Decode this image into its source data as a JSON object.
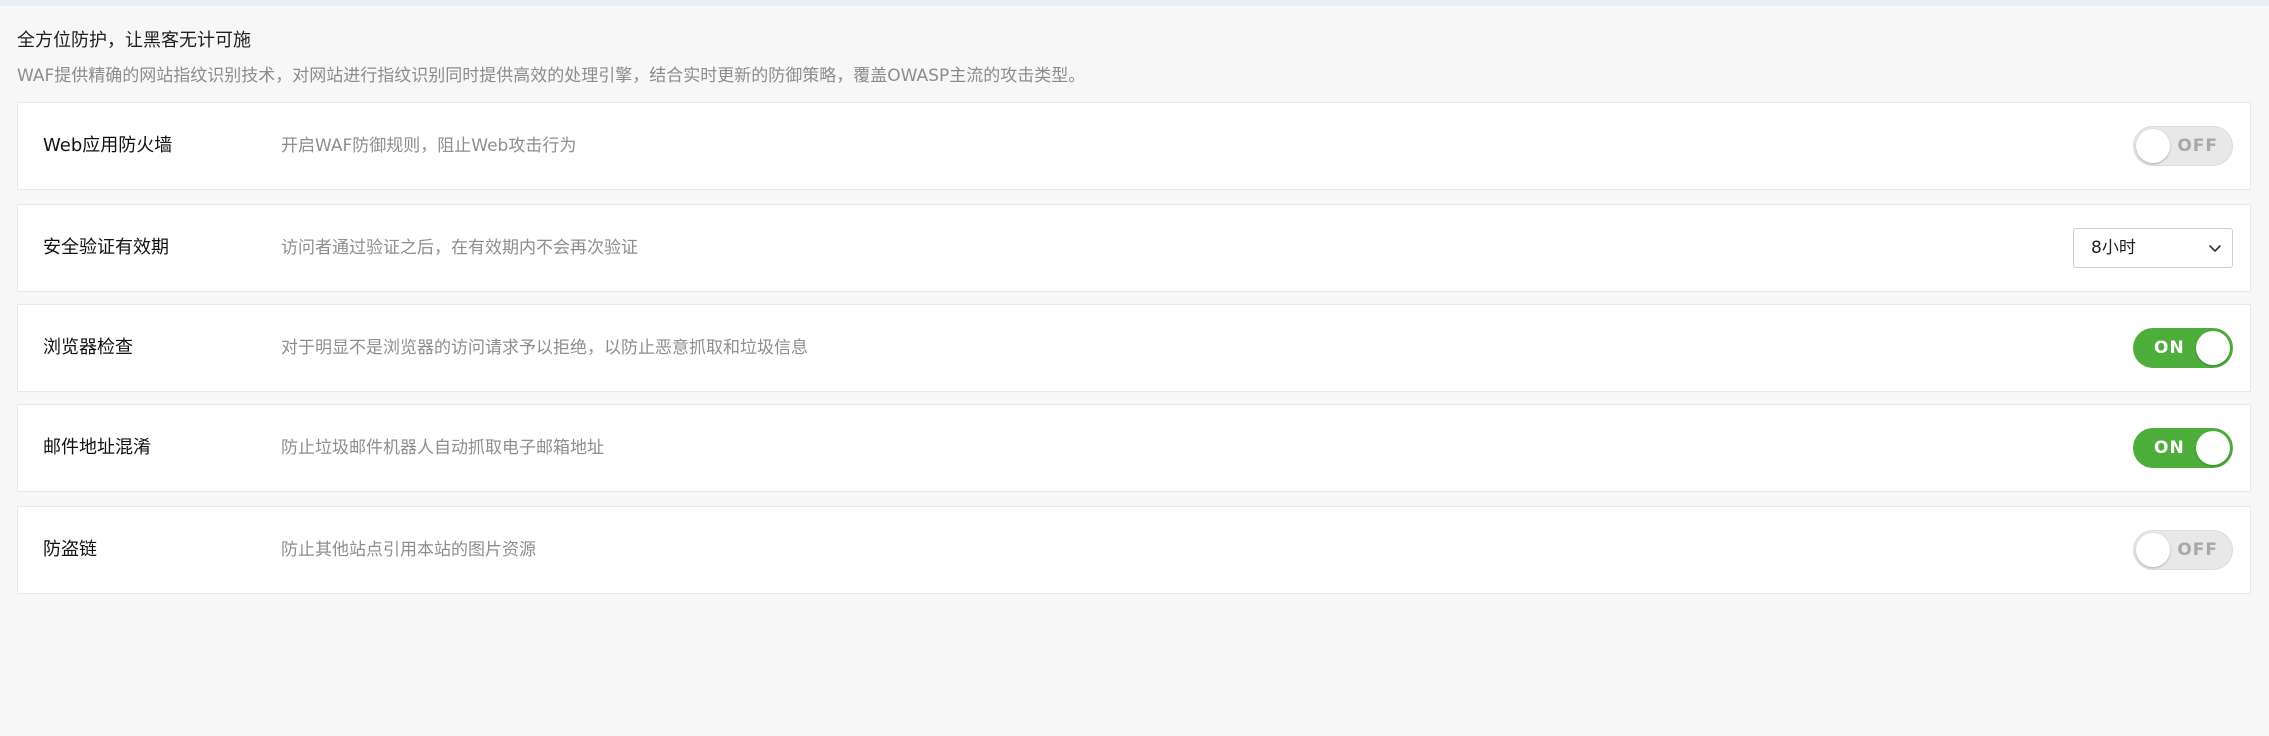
{
  "intro": {
    "title": "全方位防护，让黑客无计可施",
    "description": "WAF提供精确的网站指纹识别技术，对网站进行指纹识别同时提供高效的处理引擎，结合实时更新的防御策略，覆盖OWASP主流的攻击类型。"
  },
  "settings": [
    {
      "label": "Web应用防火墙",
      "description": "开启WAF防御规则，阻止Web攻击行为",
      "control": "toggle",
      "state_label": "OFF",
      "enabled": false
    },
    {
      "label": "安全验证有效期",
      "description": "访问者通过验证之后，在有效期内不会再次验证",
      "control": "select",
      "selected_value": "8小时",
      "icon": "chevron-down-icon"
    },
    {
      "label": "浏览器检查",
      "description": "对于明显不是浏览器的访问请求予以拒绝，以防止恶意抓取和垃圾信息",
      "control": "toggle",
      "state_label": "ON",
      "enabled": true
    },
    {
      "label": "邮件地址混淆",
      "description": "防止垃圾邮件机器人自动抓取电子邮箱地址",
      "control": "toggle",
      "state_label": "ON",
      "enabled": true
    },
    {
      "label": "防盗链",
      "description": "防止其他站点引用本站的图片资源",
      "control": "toggle",
      "state_label": "OFF",
      "enabled": false
    }
  ],
  "colors": {
    "toggle_on": "#4eae3c",
    "toggle_off": "#e8e8e8",
    "page_background": "#f7f7f7",
    "row_background": "#ffffff"
  }
}
